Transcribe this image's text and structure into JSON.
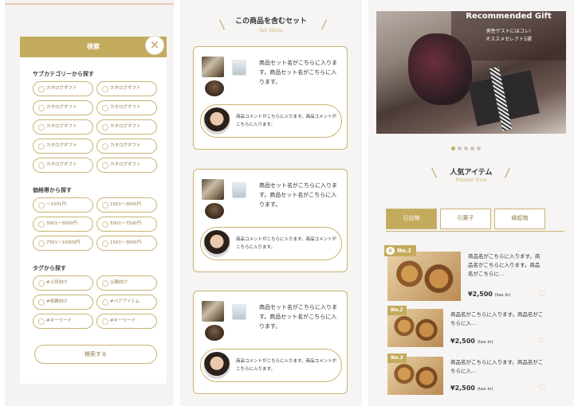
{
  "filter_panel": {
    "header": "検索",
    "close": "×",
    "subcategory_title": "サブカテゴリーから探す",
    "subcategories": [
      "カタログギフト",
      "カタログギフト",
      "カタログギフト",
      "カタログギフト",
      "カタログギフト",
      "カタログギフト",
      "カタログギフト",
      "カタログギフト",
      "カタログギフト",
      "カタログギフト"
    ],
    "price_title": "価格帯から探す",
    "prices": [
      "〜1501円",
      "1501〜3000円",
      "3001〜5000円",
      "5001〜7500円",
      "7501〜10000円",
      "1501〜3000円"
    ],
    "tag_title": "タグから探す",
    "tags": [
      "#上司向け",
      "父親向け",
      "#母親向け",
      "#ペアアイテム",
      "#キーワード",
      "#キーワード"
    ],
    "search_button": "検索する"
  },
  "set_panel": {
    "title": "この商品を含むセット",
    "subtitle": "Set Menu",
    "cards": [
      {
        "name": "商品セット名がこちらに入ります。商品セット名がこちらに入ります。",
        "comment": "商品コメントがこちらに入ります。商品コメントがこちらに入ります。"
      },
      {
        "name": "商品セット名がこちらに入ります。商品セット名がこちらに入ります。",
        "comment": "商品コメントがこちらに入ります。商品コメントがこちらに入ります。"
      },
      {
        "name": "商品セット名がこちらに入ります。商品セット名がこちらに入ります。",
        "comment": "商品コメントがこちらに入ります。商品コメントがこちらに入ります。"
      }
    ]
  },
  "ranking_panel": {
    "hero_title": "Recommended Gift",
    "hero_sub1": "男性ゲストにはコレ!",
    "hero_sub2": "オススメセレクト5選",
    "title": "人気アイテム",
    "subtitle": "Popular Item",
    "tabs": [
      "引出物",
      "引菓子",
      "縁起物"
    ],
    "items": [
      {
        "rank": "No.1",
        "name": "商品名がこちらに入ります。商品名がこちらに入ります。商品名がこちらに…",
        "price": "¥2,500",
        "tax": "(tax in)"
      },
      {
        "rank": "No.2",
        "name": "商品名がこちらに入ります。商品名がこちらに入…",
        "price": "¥2,500",
        "tax": "(tax in)"
      },
      {
        "rank": "No.3",
        "name": "商品名がこちらに入ります。商品名がこちらに入…",
        "price": "¥2,500",
        "tax": "(tax in)"
      }
    ]
  },
  "colors": {
    "accent": "#c3ab5d",
    "border": "#c9b273",
    "background": "#f4f3f2"
  }
}
